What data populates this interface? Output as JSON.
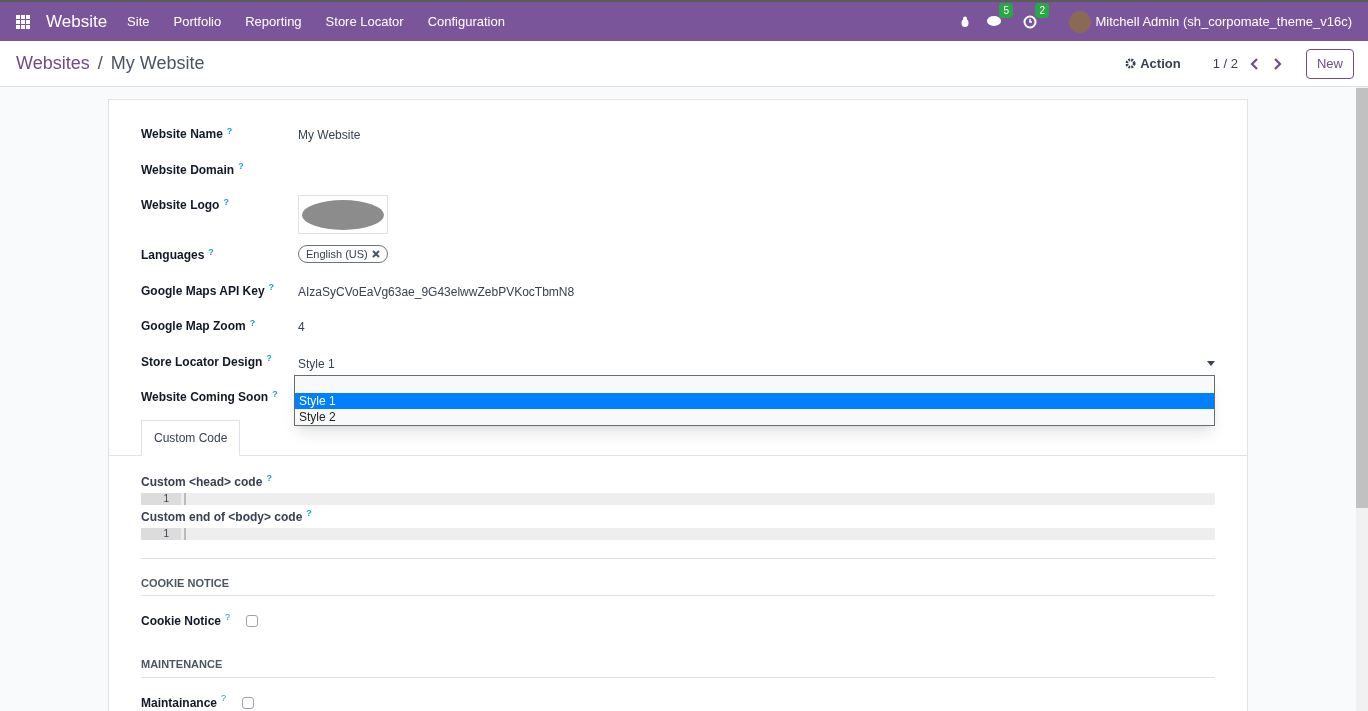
{
  "navbar": {
    "app": "Website",
    "menus": [
      "Site",
      "Portfolio",
      "Reporting",
      "Store Locator",
      "Configuration"
    ],
    "messages_count": "5",
    "activities_count": "2",
    "user": "Mitchell Admin (sh_corpomate_theme_v16c)"
  },
  "breadcrumb": {
    "parent": "Websites",
    "separator": "/",
    "current": "My Website"
  },
  "control": {
    "action": "Action",
    "pager": "1 / 2",
    "new": "New"
  },
  "fields": [
    {
      "kind": "text",
      "label": "Website Name",
      "help": "?",
      "value": "My Website"
    },
    {
      "kind": "empty",
      "label": "Website Domain",
      "help": "?"
    },
    {
      "kind": "image",
      "label": "Website Logo",
      "help": "?"
    },
    {
      "kind": "tags",
      "label": "Languages",
      "help": "?",
      "tags": [
        "English (US)"
      ]
    },
    {
      "kind": "text",
      "label": "Google Maps API Key",
      "help": "?",
      "value": "AIzaSyCVoEaVg63ae_9G43elwwZebPVKocTbmN8"
    },
    {
      "kind": "text",
      "label": "Google Map Zoom",
      "help": "?",
      "value": "4"
    },
    {
      "kind": "select",
      "label": "Store Locator Design",
      "help": "?",
      "value": "Style 1",
      "options": [
        {
          "label": "Style 1",
          "selected": true
        },
        {
          "label": "Style 2",
          "selected": false
        }
      ]
    },
    {
      "kind": "empty",
      "label": "Website Coming Soon",
      "help": "?"
    }
  ],
  "tabs": [
    {
      "label": "Custom Code",
      "selected": true
    }
  ],
  "code_fields": [
    {
      "label": "Custom <head> code",
      "help": "?",
      "line": "1"
    },
    {
      "label": "Custom end of <body> code",
      "help": "?",
      "line": "1"
    }
  ],
  "sections": [
    {
      "title": "COOKIE NOTICE",
      "label": "Cookie Notice",
      "help": "?",
      "checked": false
    },
    {
      "title": "MAINTENANCE",
      "label": "Maintainance",
      "help": "?",
      "checked": false
    }
  ]
}
